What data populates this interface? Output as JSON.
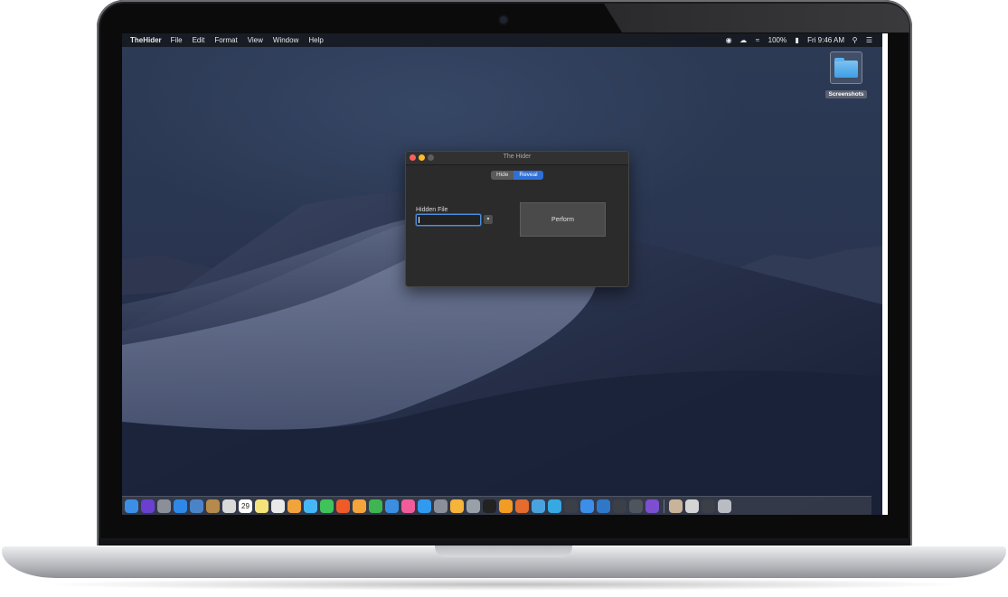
{
  "menubar": {
    "app_name": "TheHider",
    "items": [
      "File",
      "Edit",
      "Format",
      "View",
      "Window",
      "Help"
    ],
    "battery": "100%",
    "clock": "Fri 9:46 AM"
  },
  "desktop": {
    "folder_label": "Screenshots"
  },
  "window": {
    "title": "The Hider",
    "tabs": [
      {
        "label": "Hide",
        "active": false
      },
      {
        "label": "Reveal",
        "active": true
      }
    ],
    "field_label": "Hidden File",
    "field_value": "",
    "perform_label": "Perform"
  },
  "dock": {
    "calendar_day": "29",
    "apps": [
      {
        "icon": "finder-icon",
        "color": "#3d8fe6"
      },
      {
        "icon": "siri-icon",
        "color": "#6b3fd0"
      },
      {
        "icon": "launchpad-icon",
        "color": "#8a8f99"
      },
      {
        "icon": "safari-icon",
        "color": "#2f88e8"
      },
      {
        "icon": "preview-icon",
        "color": "#4a84c8"
      },
      {
        "icon": "notes-book-icon",
        "color": "#b58a4a"
      },
      {
        "icon": "photos-viewer-icon",
        "color": "#d9d9d9"
      },
      {
        "icon": "calendar-icon",
        "color": "#ffffff"
      },
      {
        "icon": "stickies-icon",
        "color": "#f4e27a"
      },
      {
        "icon": "textedit-icon",
        "color": "#e9e9e9"
      },
      {
        "icon": "photos-icon",
        "color": "#f1a33c"
      },
      {
        "icon": "messages-icon",
        "color": "#46b7f5"
      },
      {
        "icon": "facetime-icon",
        "color": "#3fc35b"
      },
      {
        "icon": "brave-icon",
        "color": "#f05a28"
      },
      {
        "icon": "pages-icon",
        "color": "#f3a43a"
      },
      {
        "icon": "numbers-icon",
        "color": "#3fb551"
      },
      {
        "icon": "keynote-icon",
        "color": "#3b8ee0"
      },
      {
        "icon": "itunes-icon",
        "color": "#f25c9a"
      },
      {
        "icon": "app-store-icon",
        "color": "#2f9af0"
      },
      {
        "icon": "system-preferences-icon",
        "color": "#8a8f99"
      },
      {
        "icon": "sketch-icon",
        "color": "#f7b43a"
      },
      {
        "icon": "keychain-icon",
        "color": "#9aa0a8"
      },
      {
        "icon": "terminal-icon",
        "color": "#222222"
      },
      {
        "icon": "sublime-icon",
        "color": "#f39c23"
      },
      {
        "icon": "firefox-icon",
        "color": "#e66b2e"
      },
      {
        "icon": "mu-editor-icon",
        "color": "#4aa3df"
      },
      {
        "icon": "telegram-icon",
        "color": "#37a9e2"
      },
      {
        "icon": "activity-monitor-icon",
        "color": "#3a3f48"
      },
      {
        "icon": "xcode-icon",
        "color": "#3b8fe8"
      },
      {
        "icon": "vscode-icon",
        "color": "#2f78c7"
      },
      {
        "icon": "console-icon",
        "color": "#3a3f48"
      },
      {
        "icon": "grid-app-icon",
        "color": "#50545c"
      },
      {
        "icon": "affinity-icon",
        "color": "#7c4fd0"
      },
      {
        "icon": "downloads-stack-icon",
        "color": "#c9b49a"
      },
      {
        "icon": "document-stack-icon",
        "color": "#d4d4d4"
      },
      {
        "icon": "screenshot-stack-icon",
        "color": "#3a3f48"
      },
      {
        "icon": "trash-icon",
        "color": "#b9bcc2"
      }
    ]
  }
}
